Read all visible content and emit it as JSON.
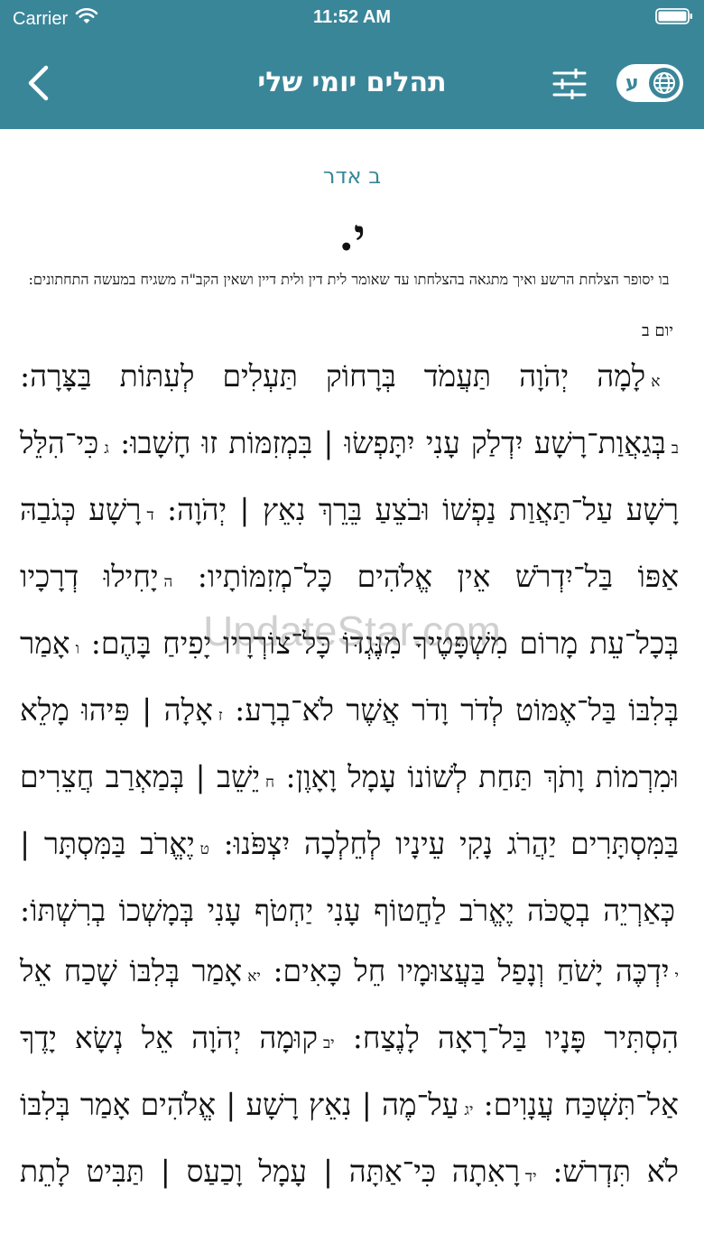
{
  "status": {
    "carrier": "Carrier",
    "time": "11:52 AM"
  },
  "nav": {
    "title": "תהלים יומי שלי",
    "lang_letter": "ע"
  },
  "content": {
    "date": "ב אדר",
    "chapter": "י.",
    "summary": "בו יסופר הצלחת הרשע ואיך מתגאה בהצלחתו עד שאומר לית דין ולית דיין ושאין הקב\"ה משגיח במעשה התחתונים:",
    "day_label": "יום ב",
    "verses": [
      {
        "num": "א",
        "text": "לָמָה יְהֹוָה תַּעֲמֹד בְּרָחוֹק תַּעְלִים לְעִתּוֹת בַּצָּרָה:"
      },
      {
        "num": "ב",
        "text": "בְּגַאֲוַת־רָשָׁע יִדְלַק עָנִי יִתָּפְשׂוּ | בִּמְזִמּוֹת זוּ חָשָׁבוּ:"
      },
      {
        "num": "ג",
        "text": "כִּי־הִלֵּל רָשָׁע עַל־תַּאֲוַת נַפְשׁוֹ וּבֹצֵעַ בֵּרֵךְ נִאֵץ | יְהֹוָה:"
      },
      {
        "num": "ד",
        "text": "רָשָׁע כְּגֹבַהּ אַפּוֹ בַּל־יִדְרֹשׁ אֵין אֱלֹהִים כָּל־מְזִמּוֹתָיו:"
      },
      {
        "num": "ה",
        "text": "יָחִילוּ דְרָכָיו בְּכָל־עֵת מָרוֹם מִשְׁפָּטֶיךָ מִנֶּגְדּוֹ כָּל־צוֹרְרָיו יָפִיחַ בָּהֶם:"
      },
      {
        "num": "ו",
        "text": "אָמַר בְּלִבּוֹ בַּל־אֶמּוֹט לְדֹר וָדֹר אֲשֶׁר לֹא־בְרָע:"
      },
      {
        "num": "ז",
        "text": "אָלָה | פִּיהוּ מָלֵא וּמִרְמוֹת וָתֹךְ תַּחַת לְשׁוֹנוֹ עָמָל וָאָוֶן:"
      },
      {
        "num": "ח",
        "text": "יֵשֵׁב | בְּמַאְרַב חֲצֵרִים בַּמִּסְתָּרִים יַהֲרֹג נָקִי עֵינָיו לְחֵלְכָה יִצְפֹּנוּ:"
      },
      {
        "num": "ט",
        "text": "יֶאֱרֹב בַּמִּסְתָּר | כְּאַרְיֵה בְסֻכֹּה יֶאֱרֹב לַחֲטוֹף עָנִי יַחְטֹף עָנִי בְּמָשְׁכוֹ בְרִשְׁתּוֹ:"
      },
      {
        "num": "י",
        "text": "יִדְכֶּה יָשֹׁחַ וְנָפַל בַּעֲצוּמָיו חֵל כָּאִים:"
      },
      {
        "num": "יא",
        "text": "אָמַר בְּלִבּוֹ שָׁכַח אֵל הִסְתִּיר פָּנָיו בַּל־רָאָה לָנֶצַח:"
      },
      {
        "num": "יב",
        "text": "קוּמָה יְהֹוָה אֵל נְשָׂא יָדֶךָ אַל־תִּשְׁכַּח עֲנָוִים:"
      },
      {
        "num": "יג",
        "text": "עַל־מֶה | נִאֵץ רָשָׁע | אֱלֹהִים אָמַר בְּלִבּוֹ לֹא תִּדְרֹשׁ:"
      },
      {
        "num": "יד",
        "text": "רָאִתָה כִּי־אַתָּה | עָמָל וָכַעַס | תַּבִּיט לָתֵת"
      }
    ]
  },
  "watermark": "UpdateStar.com"
}
